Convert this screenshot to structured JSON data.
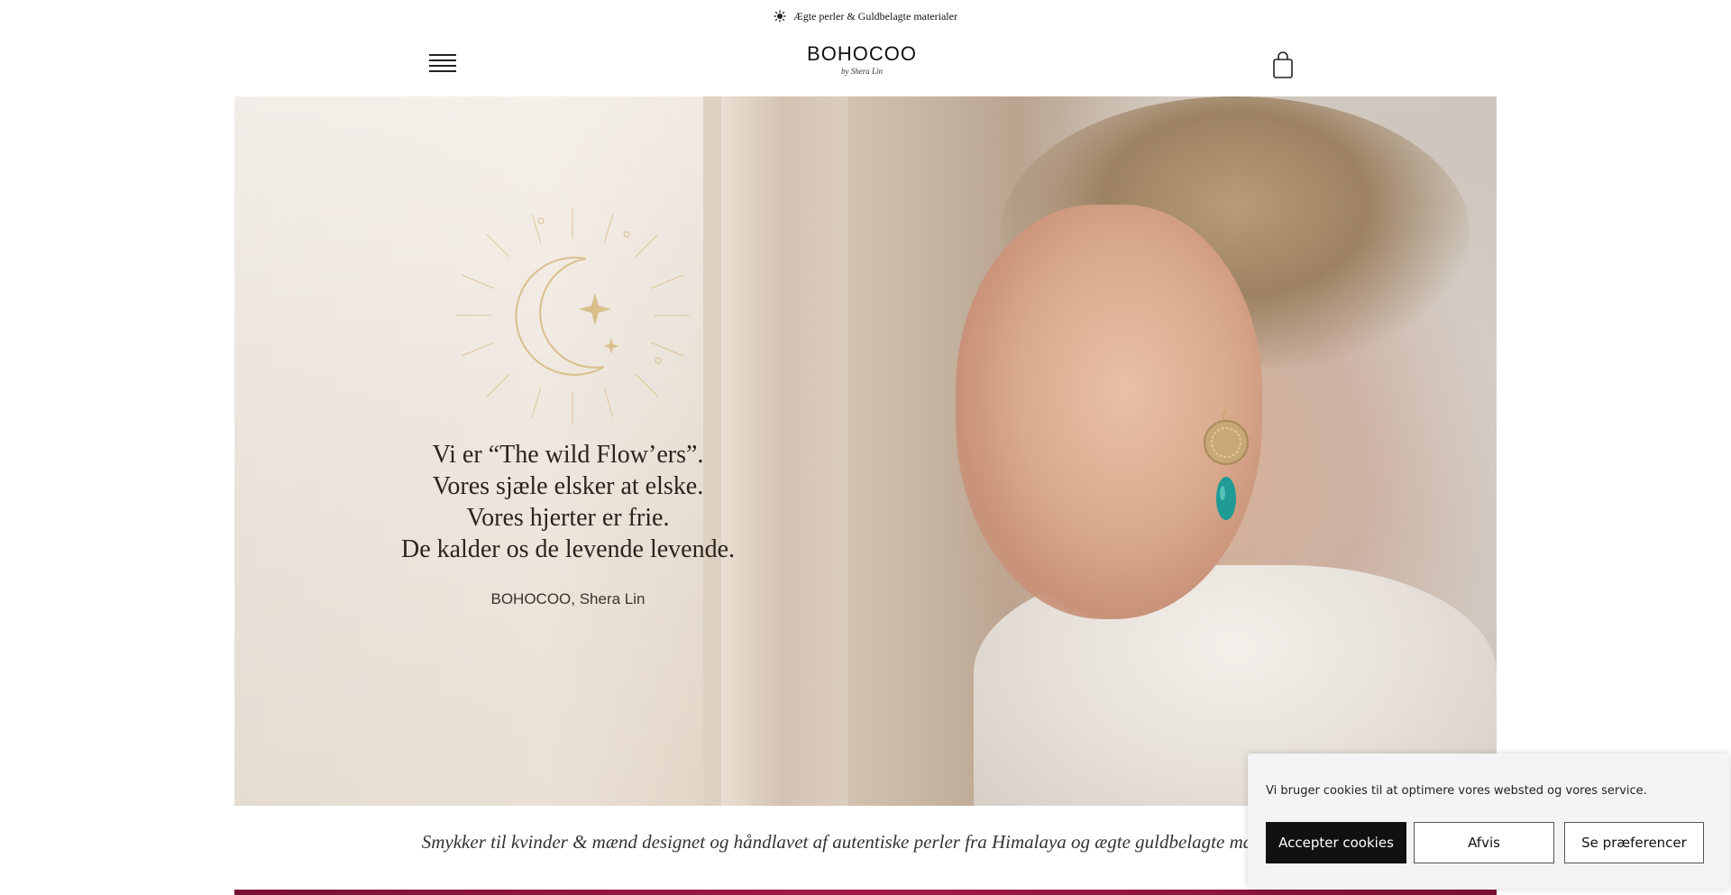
{
  "announcement": {
    "icon": "sun-icon",
    "text": "Ægte perler & Guldbelagte materialer"
  },
  "header": {
    "menu_icon": "hamburger-menu-icon",
    "logo": {
      "word": "BOHOCOO",
      "tagline": "by Shera Lin"
    },
    "cart_icon": "shopping-bag-icon"
  },
  "hero": {
    "quote_lines": [
      "Vi er “The wild Flow’ers”.",
      "Vores sjæle elsker at elske.",
      "Vores hjerter er frie.",
      "De kalder os de levende levende."
    ],
    "signature": "BOHOCOO, Shera Lin",
    "emblem_icon": "moon-sunburst-icon"
  },
  "tagline": "Smykker til kvinder & mænd designet og håndlavet af autentiske perler fra Himalaya og ægte guldbelagte materialer",
  "cookie_banner": {
    "message": "Vi bruger cookies til at optimere vores websted og vores service.",
    "accept_label": "Accepter cookies",
    "decline_label": "Afvis",
    "preferences_label": "Se præferencer"
  },
  "colors": {
    "accent_strip": "#a21a4a",
    "button_dark": "#111111"
  }
}
